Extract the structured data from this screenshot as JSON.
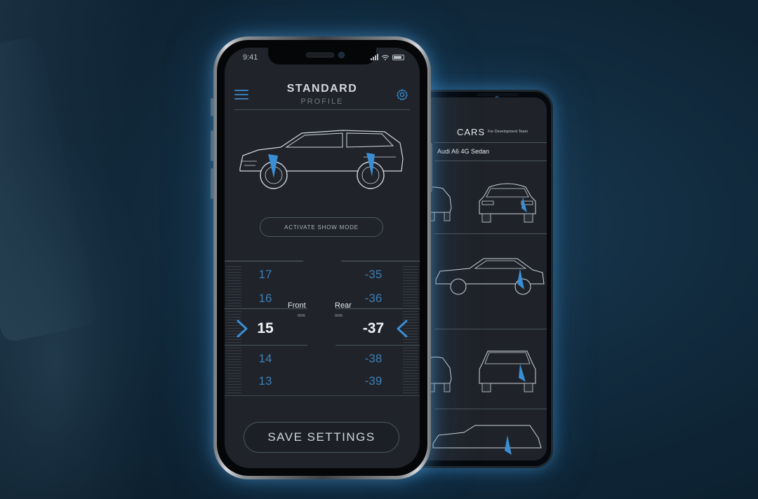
{
  "front_phone": {
    "status_time": "9:41",
    "title": "STANDARD",
    "subtitle": "PROFILE",
    "show_mode_label": "ACTIVATE SHOW MODE",
    "front": {
      "label": "Front",
      "unit": "mm",
      "values": [
        "17",
        "16",
        "15",
        "14",
        "13"
      ],
      "selected": "15"
    },
    "rear": {
      "label": "Rear",
      "unit": "mm",
      "values": [
        "-35",
        "-36",
        "-37",
        "-38",
        "-39"
      ],
      "selected": "-37"
    },
    "save_label": "SAVE SETTINGS"
  },
  "back_phone": {
    "title": "CARS",
    "subtitle": "For Development Team",
    "car_name": "Audi A6 4G Sedan"
  },
  "colors": {
    "accent": "#3a8ed4",
    "screen_bg": "#202329",
    "glow": "#4696d2"
  },
  "icons": [
    "menu-icon",
    "gear-icon",
    "chevron-right-icon",
    "chevron-left-icon",
    "signal-icon",
    "wifi-icon",
    "battery-icon"
  ]
}
